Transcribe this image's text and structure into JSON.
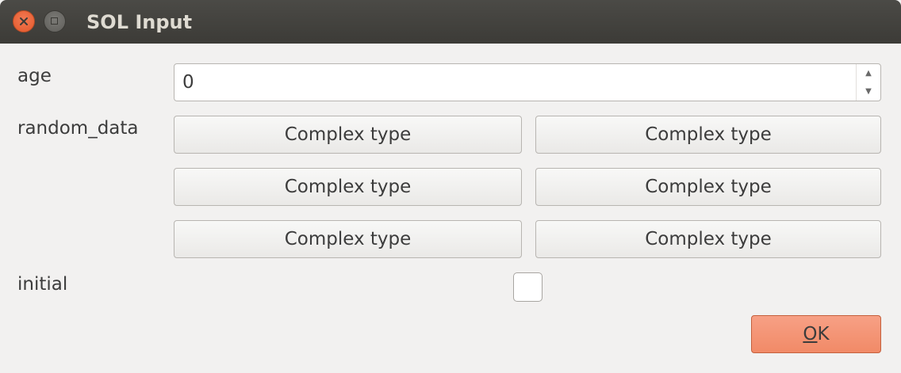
{
  "window": {
    "title": "SOL Input",
    "icons": {
      "close": "close-icon",
      "maximize": "maximize-icon"
    }
  },
  "form": {
    "age": {
      "label": "age",
      "value": "0"
    },
    "random_data": {
      "label": "random_data",
      "buttons": [
        "Complex type",
        "Complex type",
        "Complex type",
        "Complex type",
        "Complex type",
        "Complex type"
      ]
    },
    "initial": {
      "label": "initial",
      "checked": false
    }
  },
  "actions": {
    "ok_mnemonic": "O",
    "ok_rest": "K"
  },
  "colors": {
    "titlebar": "#3c3b37",
    "close_button": "#e95420",
    "ok_button": "#f18a67",
    "background": "#f2f1f0"
  }
}
